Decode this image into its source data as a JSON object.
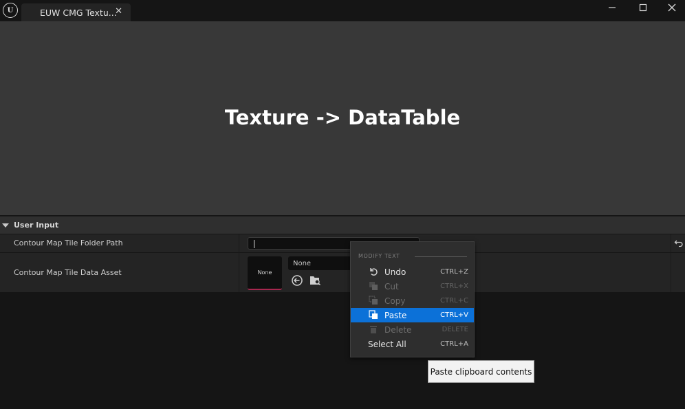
{
  "titlebar": {
    "logo_text": "U",
    "tab_label": "EUW CMG Textu...",
    "tab_close": "✕",
    "minimize": "—",
    "maximize": "☐",
    "close": "✕"
  },
  "header": {
    "title": "Texture -> DataTable"
  },
  "details": {
    "section_title": "User Input",
    "rows": [
      {
        "label": "Contour Map Tile Folder Path",
        "value": ""
      },
      {
        "label": "Contour Map Tile Data Asset",
        "thumbnail_text": "None",
        "combo_value": "None"
      }
    ]
  },
  "context_menu": {
    "heading": "MODIFY TEXT",
    "items": [
      {
        "label": "Undo",
        "shortcut": "CTRL+Z",
        "icon": "undo-icon",
        "enabled": true
      },
      {
        "label": "Cut",
        "shortcut": "CTRL+X",
        "icon": "cut-icon",
        "enabled": false
      },
      {
        "label": "Copy",
        "shortcut": "CTRL+C",
        "icon": "copy-icon",
        "enabled": false
      },
      {
        "label": "Paste",
        "shortcut": "CTRL+V",
        "icon": "paste-icon",
        "enabled": true,
        "highlighted": true
      },
      {
        "label": "Delete",
        "shortcut": "DELETE",
        "icon": "trash-icon",
        "enabled": false
      },
      {
        "label": "Select All",
        "shortcut": "CTRL+A",
        "enabled": true
      }
    ]
  },
  "tooltip": {
    "text": "Paste clipboard contents"
  },
  "colors": {
    "highlight": "#0c71d8",
    "thumbnail_accent": "#a8274f",
    "header_bg": "#383838"
  }
}
